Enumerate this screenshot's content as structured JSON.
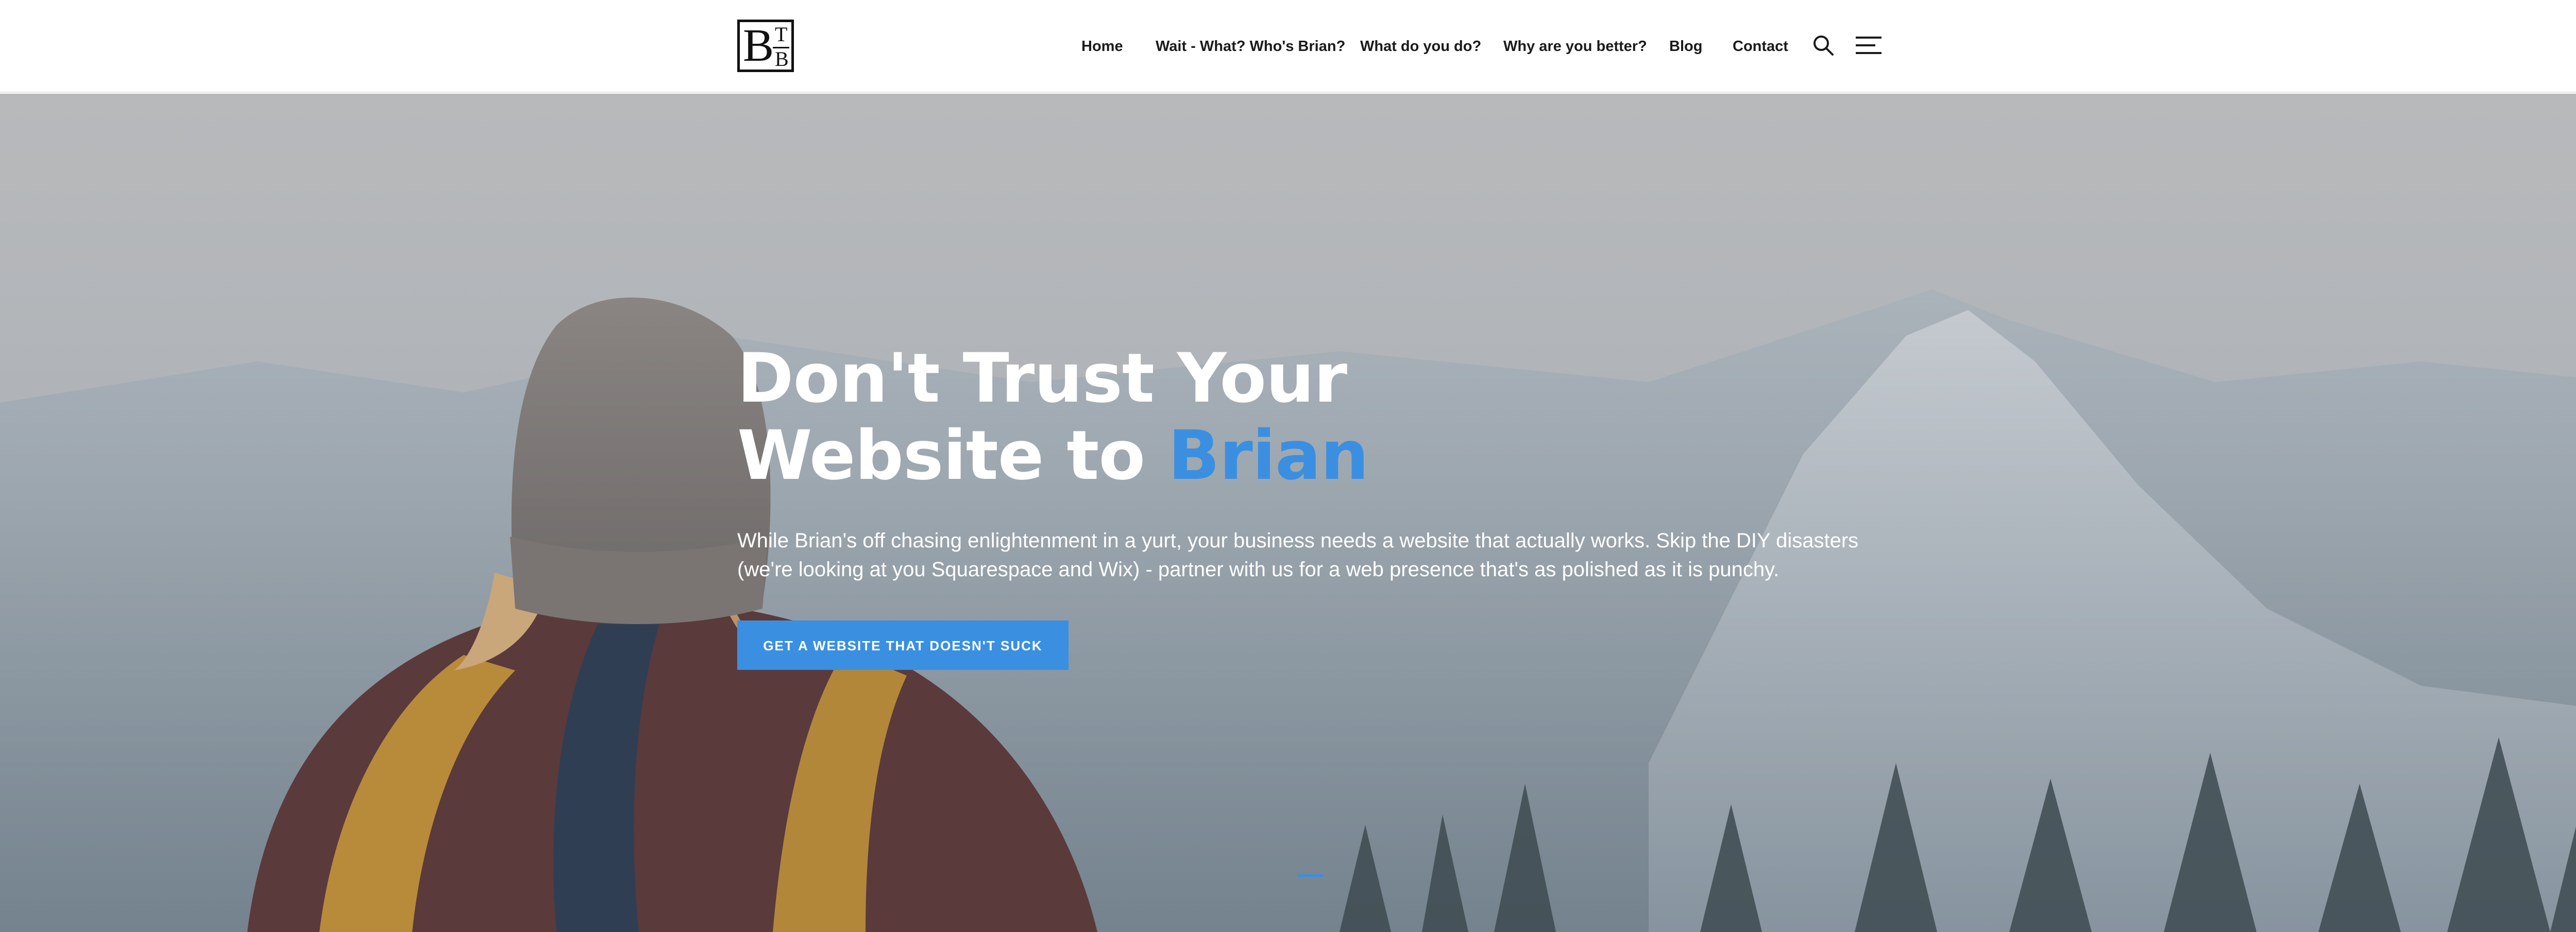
{
  "logo": {
    "big_letter": "B",
    "small_top": "T",
    "small_bottom": "B"
  },
  "nav": {
    "items": [
      {
        "label": "Home"
      },
      {
        "label": "Wait - What? Who's Brian?"
      },
      {
        "label": "What do you do?"
      },
      {
        "label": "Why are you better?"
      },
      {
        "label": "Blog"
      },
      {
        "label": "Contact"
      }
    ],
    "search_icon": "search-icon",
    "menu_icon": "hamburger-menu-icon"
  },
  "hero": {
    "title_line1": "Don't Trust Your",
    "title_line2_prefix": "Website to ",
    "title_line2_accent": "Brian",
    "subtitle": "While Brian's off chasing enlightenment in a yurt, your business needs a website that actually works. Skip the DIY disasters (we're looking at you Squarespace and Wix) - partner with us for a web presence that's as polished as it is punchy.",
    "cta_label": "GET A WEBSITE THAT DOESN'T SUCK"
  },
  "colors": {
    "accent": "#3b8fe0",
    "header_bg": "#ffffff",
    "nav_text": "#1b1b1b"
  }
}
